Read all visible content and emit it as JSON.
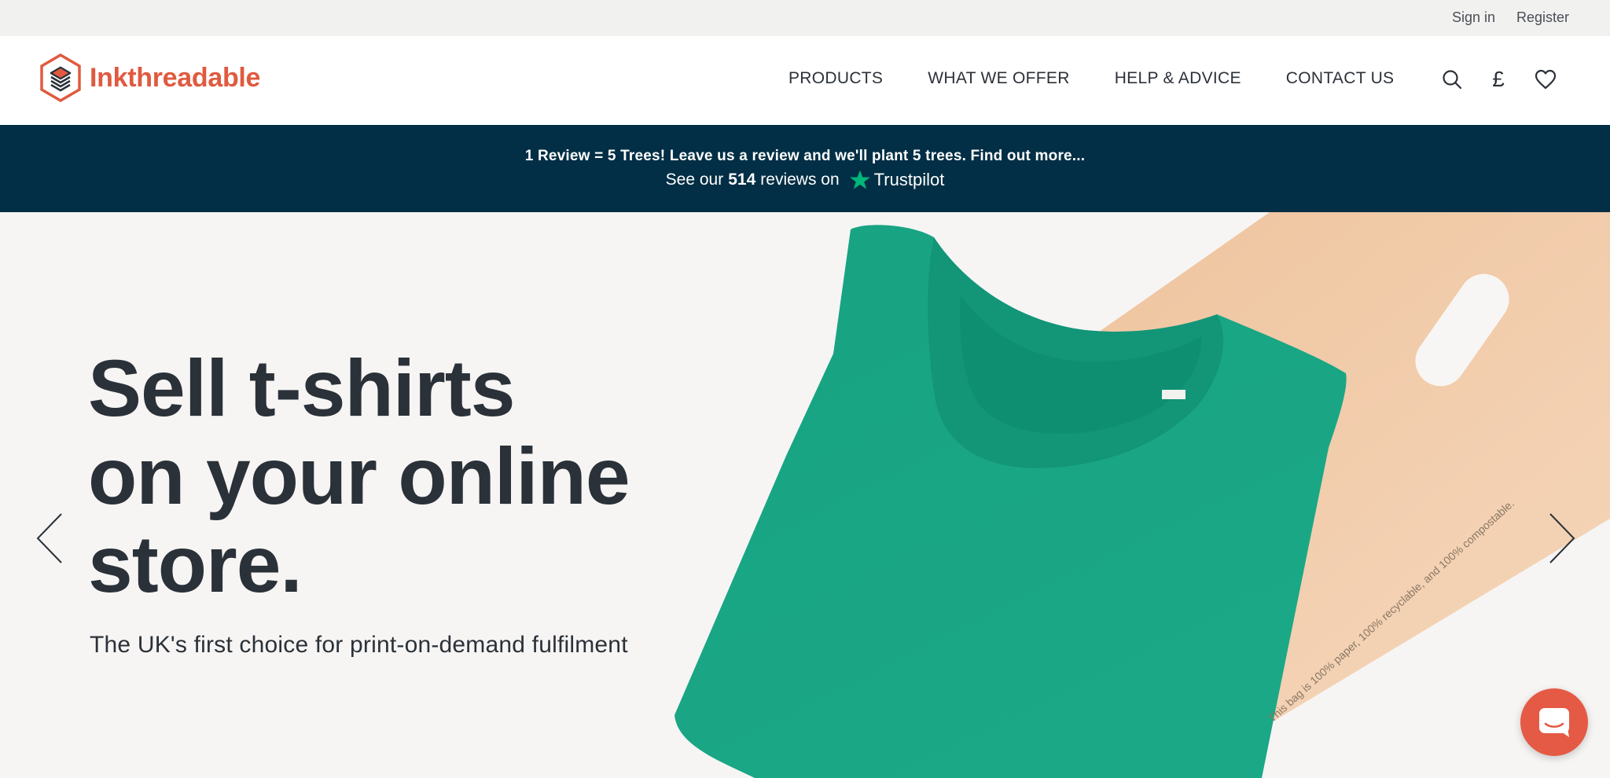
{
  "utility": {
    "sign_in": "Sign in",
    "register": "Register"
  },
  "brand": {
    "name": "Inkthreadable",
    "color": "#e05a3f"
  },
  "nav": {
    "items": [
      {
        "label": "PRODUCTS"
      },
      {
        "label": "WHAT WE OFFER"
      },
      {
        "label": "HELP & ADVICE"
      },
      {
        "label": "CONTACT US"
      }
    ],
    "icons": {
      "search": "search-icon",
      "currency": "£",
      "wishlist": "heart-icon"
    }
  },
  "promo": {
    "text": "1 Review = 5 Trees! Leave us a review and we'll plant 5 trees. Find out more...",
    "trustpilot_prefix": "See our",
    "trustpilot_count": "514",
    "trustpilot_suffix": "reviews on",
    "trustpilot_brand": "Trustpilot",
    "background": "#022f45",
    "star_color": "#00b67a"
  },
  "hero": {
    "title_lines": [
      "Sell t-shirts",
      "on your online",
      "store."
    ],
    "subtitle": "The UK's first choice for print-on-demand fulfilment",
    "bag_print": "This bag is 100% paper, 100% recyclable, and 100% compostable.",
    "shirt_color": "#1aa383",
    "bag_color": "#f0cba7"
  },
  "chat": {
    "icon": "chat-icon",
    "color": "#e55a45"
  }
}
